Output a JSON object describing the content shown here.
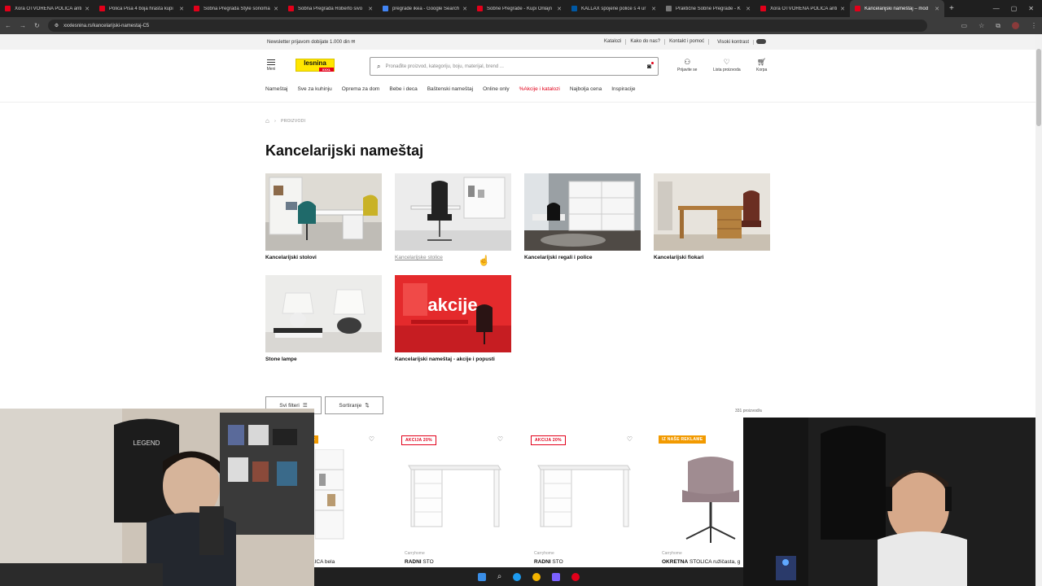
{
  "browser": {
    "tabs": [
      {
        "label": "Xora OTVORENA POLICA anti",
        "color": "#e2001a"
      },
      {
        "label": "Polica Pisa 4 boja hrasta kupi",
        "color": "#e2001a"
      },
      {
        "label": "Sobna Pregrada Style sonoma",
        "color": "#e2001a"
      },
      {
        "label": "Sobna Pregrada Roberto sivo",
        "color": "#e2001a"
      },
      {
        "label": "pregrade ikea - Google Search",
        "color": "#4285f4"
      },
      {
        "label": "Sobne Pregrade - Kupi Onlajn",
        "color": "#e2001a"
      },
      {
        "label": "KALLAX spojene police s 4 ur",
        "color": "#0058a3"
      },
      {
        "label": "Praktične Sobne Pregrade - K",
        "color": "#777777"
      },
      {
        "label": "Xora OTVORENA POLICA anti",
        "color": "#e2001a"
      },
      {
        "label": "Kancelarijski nameštaj – mod",
        "color": "#e2001a",
        "active": true
      }
    ],
    "url": "xxxlesnina.rs/kancelarijski-namestaj-C5"
  },
  "util": {
    "newsletter": "Newsletter prijavom dobijate 1.000 din",
    "links": [
      "Katalozi",
      "Kako do nas?",
      "Kontakt i pomoć",
      "Visoki kontrast"
    ]
  },
  "header": {
    "menu_label": "Meni",
    "logo_text": "lesnina",
    "logo_sub": "XXXL",
    "search_placeholder": "Pronađite proizvod, kategoriju, boju, materijal, brend ...",
    "login_label": "Prijavite se",
    "wishlist_label": "Lista proizvoda",
    "cart_label": "Korpa"
  },
  "nav": [
    "Nameštaj",
    "Sve za kuhinju",
    "Oprema za dom",
    "Bebe i deca",
    "Baštenski nameštaj",
    "Online only",
    "%Akcije i katalozi",
    "Najbolja cena",
    "Inspiracije"
  ],
  "breadcrumb": {
    "current": "PROIZVODI"
  },
  "page_title": "Kancelarijski nameštaj",
  "categories": [
    {
      "label": "Kancelarijski stolovi"
    },
    {
      "label": "Kancelarijske stolice"
    },
    {
      "label": "Kancelarijski regali i police"
    },
    {
      "label": "Kancelarijski fiokari"
    },
    {
      "label": "Stone lampe"
    },
    {
      "label": "Kancelarijski nameštaj - akcije i popusti",
      "overlay": "akcije"
    }
  ],
  "filters": {
    "all_filters": "Svi filteri",
    "sort": "Sortiranje",
    "count": "331 proizvod/a"
  },
  "products": [
    {
      "badge": "ME",
      "badge_type": "solid",
      "brand": "",
      "name_bold": "",
      "name_rest": "LICA bela"
    },
    {
      "badge": "AKCIJA 20%",
      "badge_type": "outline",
      "brand": "Carryhome",
      "name_bold": "RADNI",
      "name_rest": " STO"
    },
    {
      "badge": "AKCIJA 20%",
      "badge_type": "outline",
      "brand": "Carryhome",
      "name_bold": "RADNI",
      "name_rest": " STO"
    },
    {
      "badge": "IZ NAŠE REKLAME",
      "badge_type": "solid",
      "brand": "Carryhome",
      "name_bold": "OKRETNA",
      "name_rest": " STOLICA ružičasta, g"
    }
  ]
}
